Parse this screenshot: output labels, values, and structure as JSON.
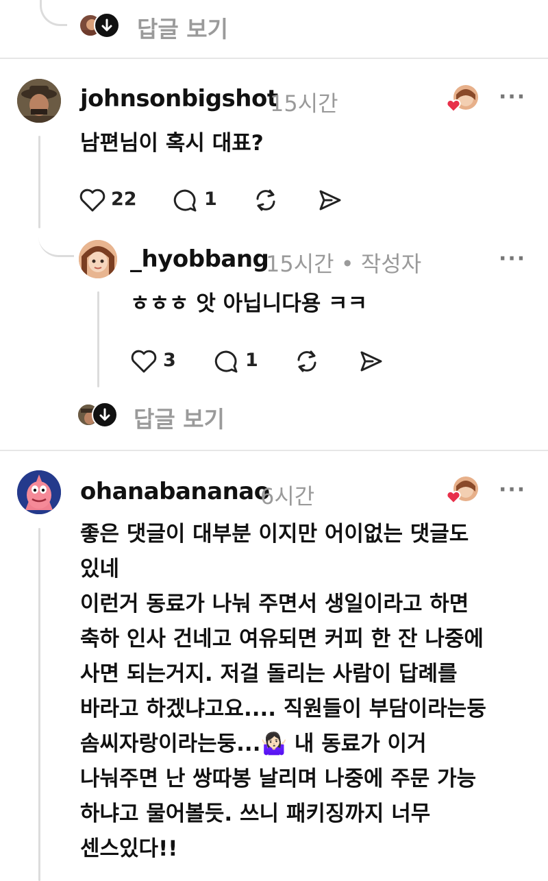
{
  "top": {
    "view_replies": "답글 보기"
  },
  "comment1": {
    "username": "johnsonbigshot",
    "time": "15시간",
    "text": "남편님이 혹시 대표?",
    "likes": "22",
    "replies": "1",
    "more": "···",
    "reply": {
      "username": "_hyobbang",
      "time_author": "15시간 • 작성자",
      "text": "ㅎㅎㅎ 앗 아닙니다용 ㅋㅋ",
      "likes": "3",
      "replies": "1",
      "more": "···"
    },
    "view_replies": "답글 보기"
  },
  "comment2": {
    "username": "ohanabananao",
    "time": "6시간",
    "more": "···",
    "lines": [
      "좋은 댓글이 대부분 이지만 어이없는 댓글도",
      "있네",
      "이런거 동료가 나눠 주면서 생일이라고 하면",
      "축하 인사 건네고 여유되면 커피 한 잔 나중에",
      "사면 되는거지. 저걸 돌리는 사람이 답례를",
      "바라고 하겠냐고요.... 직원들이 부담이라는둥",
      "솜씨자랑이라는둥...🤷🏻‍♀️ 내 동료가 이거",
      "나눠주면 난 쌍따봉 날리며 나중에 주문 가능",
      "하냐고 물어볼듯. 쓰니 패키징까지 너무",
      "센스있다!!"
    ]
  },
  "colors": {
    "text": "#111111",
    "muted": "#9a9a9a",
    "divider": "#e6e6e6",
    "heart": "#e8304a"
  },
  "icons": [
    "heart-icon",
    "comment-icon",
    "repost-icon",
    "share-icon",
    "more-icon",
    "arrow-down-icon",
    "liked-heart-icon"
  ]
}
